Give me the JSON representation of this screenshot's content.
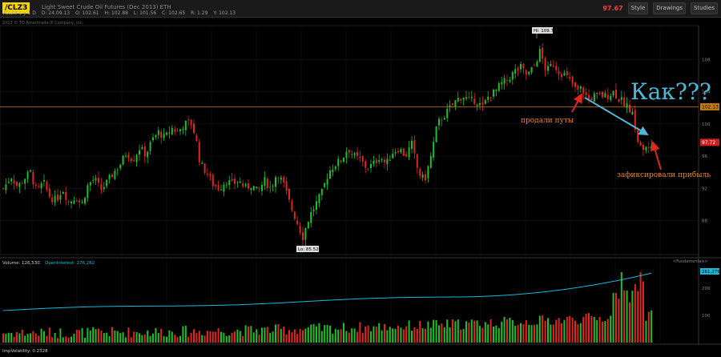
{
  "toolbar": {
    "symbol": "/CLZ3",
    "description": "Light Sweet Crude Oil Futures (Dec 2013) ETH",
    "price_badge": "97.67",
    "buttons": [
      "Style",
      "Drawings",
      "Studies"
    ]
  },
  "quote": {
    "symbol_tf": "/CLZ3 1 y 1 D",
    "d": "D: 24.09.13",
    "o": "O: 102.61",
    "h": "H: 102.88",
    "l": "L: 101.56",
    "c": "C: 102.65",
    "r": "R: 1.29",
    "y": "Y: 102.13"
  },
  "copyright": "2013 © TD Ameritrade IP Company, Inc.",
  "labels": {
    "high": "Hi: 109.7",
    "low": "Lo: 85.52",
    "price_line": "102.13",
    "last_price": "97.72",
    "volume_header": "Volume: 126,530",
    "open_interest": "OpenInterest: 276,262",
    "oi_value": "261,279",
    "impvol": "ImpVolatility: 0.2328",
    "fundamentals": "<Fundamentals>"
  },
  "annotations": {
    "question": "Как???",
    "sold_puts": "продали путы",
    "took_profit": "зафиксировали прибыль"
  },
  "colors": {
    "up": "#1fbf2a",
    "down": "#e0261e",
    "oi_line": "#19b8d8",
    "price_line": "#c47a10",
    "arrow_red": "#e0261e",
    "arrow_blue": "#4fb8d8",
    "ann_text": "#e8862a",
    "question_text": "#4fb8d8"
  },
  "chart_data": {
    "type": "candlestick",
    "price_axis_ticks": [
      88,
      92,
      96,
      100,
      104,
      108
    ],
    "ylim": [
      84,
      112
    ],
    "volume_axis_ticks": [
      100,
      200
    ],
    "price_path": [
      [
        0,
        92.0
      ],
      [
        10,
        93.5
      ],
      [
        18,
        92.2
      ],
      [
        26,
        93.2
      ],
      [
        34,
        94.0
      ],
      [
        42,
        91.5
      ],
      [
        50,
        92.8
      ],
      [
        58,
        91.0
      ],
      [
        66,
        90.5
      ],
      [
        74,
        92.0
      ],
      [
        82,
        90.2
      ],
      [
        90,
        91.0
      ],
      [
        98,
        90.0
      ],
      [
        106,
        92.5
      ],
      [
        114,
        93.2
      ],
      [
        122,
        91.8
      ],
      [
        130,
        92.8
      ],
      [
        138,
        94.0
      ],
      [
        146,
        95.0
      ],
      [
        154,
        96.5
      ],
      [
        162,
        95.5
      ],
      [
        170,
        97.0
      ],
      [
        178,
        96.2
      ],
      [
        186,
        98.0
      ],
      [
        194,
        99.0
      ],
      [
        202,
        98.2
      ],
      [
        210,
        99.5
      ],
      [
        218,
        99.0
      ],
      [
        226,
        100.0
      ],
      [
        234,
        100.2
      ],
      [
        240,
        98.5
      ],
      [
        246,
        95.0
      ],
      [
        254,
        94.0
      ],
      [
        262,
        92.5
      ],
      [
        270,
        92.0
      ],
      [
        278,
        93.0
      ],
      [
        286,
        92.5
      ],
      [
        294,
        93.0
      ],
      [
        302,
        92.0
      ],
      [
        310,
        92.5
      ],
      [
        318,
        91.5
      ],
      [
        326,
        93.0
      ],
      [
        334,
        92.0
      ],
      [
        342,
        94.0
      ],
      [
        350,
        92.5
      ],
      [
        358,
        90.0
      ],
      [
        366,
        88.0
      ],
      [
        374,
        86.0
      ],
      [
        382,
        88.5
      ],
      [
        390,
        90.0
      ],
      [
        398,
        91.5
      ],
      [
        406,
        94.0
      ],
      [
        414,
        95.0
      ],
      [
        422,
        95.5
      ],
      [
        430,
        97.0
      ],
      [
        438,
        96.0
      ],
      [
        446,
        95.5
      ],
      [
        454,
        94.5
      ],
      [
        462,
        95.0
      ],
      [
        470,
        96.0
      ],
      [
        478,
        95.0
      ],
      [
        486,
        96.5
      ],
      [
        494,
        97.0
      ],
      [
        502,
        96.0
      ],
      [
        510,
        97.5
      ],
      [
        518,
        94.0
      ],
      [
        526,
        93.0
      ],
      [
        534,
        96.0
      ],
      [
        542,
        100.0
      ],
      [
        550,
        101.0
      ],
      [
        558,
        102.0
      ],
      [
        566,
        103.0
      ],
      [
        574,
        103.5
      ],
      [
        582,
        102.8
      ],
      [
        590,
        103.0
      ],
      [
        598,
        102.0
      ],
      [
        606,
        103.5
      ],
      [
        614,
        104.0
      ],
      [
        622,
        105.0
      ],
      [
        630,
        105.5
      ],
      [
        638,
        106.5
      ],
      [
        646,
        107.0
      ],
      [
        654,
        106.0
      ],
      [
        662,
        107.0
      ],
      [
        670,
        109.0
      ],
      [
        678,
        106.5
      ],
      [
        686,
        107.5
      ],
      [
        694,
        106.5
      ],
      [
        702,
        106.0
      ],
      [
        710,
        105.0
      ],
      [
        716,
        104.0
      ],
      [
        722,
        104.5
      ],
      [
        730,
        103.0
      ],
      [
        738,
        103.5
      ],
      [
        746,
        103.5
      ],
      [
        754,
        103.5
      ],
      [
        762,
        104.0
      ],
      [
        770,
        103.0
      ],
      [
        778,
        102.5
      ],
      [
        786,
        101.0
      ],
      [
        792,
        98.0
      ],
      [
        798,
        96.5
      ],
      [
        804,
        97.5
      ],
      [
        810,
        97.7
      ]
    ]
  }
}
